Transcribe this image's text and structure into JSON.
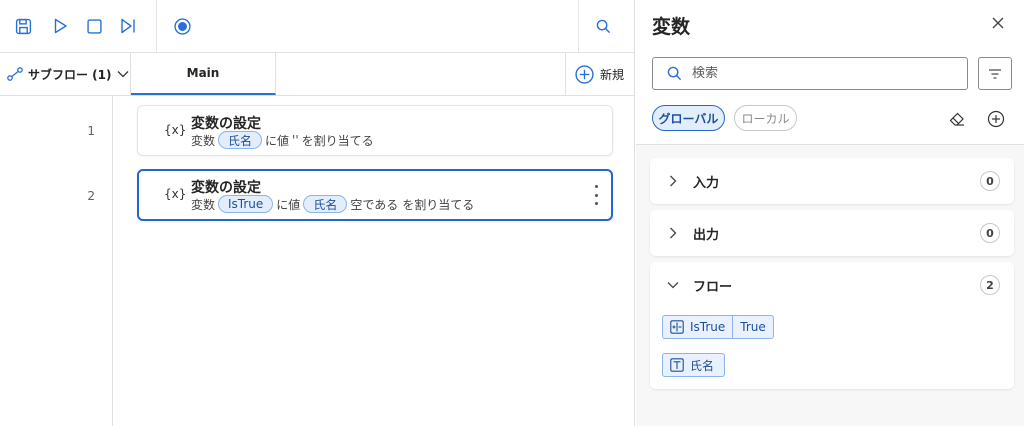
{
  "toolbar": {
    "icons": [
      "save-icon",
      "run-icon",
      "stop-icon",
      "step-icon",
      "record-icon",
      "search-icon"
    ]
  },
  "tabs": {
    "subflow_label": "サブフロー (1)",
    "main_label": "Main",
    "new_label": "新規"
  },
  "actions": [
    {
      "line": "1",
      "icon_text": "{x}",
      "title": "変数の設定",
      "desc_prefix": "変数",
      "var_chip": "氏名",
      "desc_mid": "に値",
      "desc_value": "''",
      "desc_suffix": "を割り当てる"
    },
    {
      "line": "2",
      "icon_text": "{x}",
      "title": "変数の設定",
      "desc_prefix": "変数",
      "var_chip": "IsTrue",
      "desc_mid": "に値",
      "value_chip": "氏名",
      "desc_suffix1": "空である",
      "desc_suffix2": "を割り当てる"
    }
  ],
  "variables_pane": {
    "title": "変数",
    "search_placeholder": "検索",
    "scope_tabs": [
      "グローバル",
      "ローカル"
    ],
    "sections": [
      {
        "label": "入力",
        "count": "0",
        "expanded": false
      },
      {
        "label": "出力",
        "count": "0",
        "expanded": false
      },
      {
        "label": "フロー",
        "count": "2",
        "expanded": true
      }
    ],
    "flow_variables": [
      {
        "name": "IsTrue",
        "value": "True",
        "icon": "boolean-icon"
      },
      {
        "name": "氏名",
        "icon": "text-icon"
      }
    ]
  },
  "colors": {
    "accent": "#2368c9",
    "chip_bg": "#e3eefc",
    "chip_border": "#8db4ec",
    "pane_bg": "#f7f7f7"
  }
}
